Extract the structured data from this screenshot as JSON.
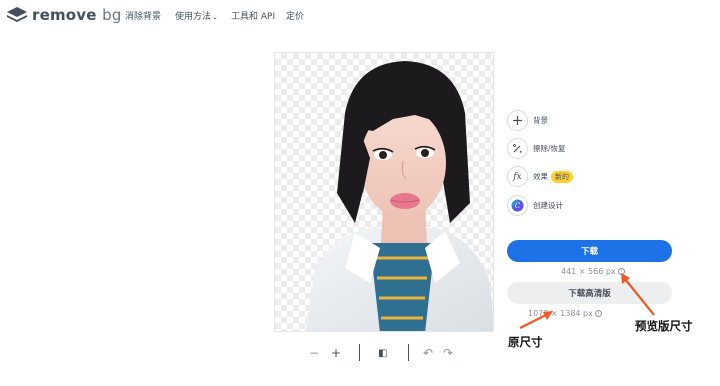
{
  "header": {
    "logo_main": "remove",
    "logo_suffix": "bg",
    "nav": [
      {
        "label": "消除背景"
      },
      {
        "label": "使用方法"
      },
      {
        "label": "工具和 API"
      },
      {
        "label": "定价"
      }
    ],
    "nav_dropdown_icon": "chevron-down-icon"
  },
  "tools": [
    {
      "icon": "plus-icon",
      "glyph": "+",
      "label": "背景"
    },
    {
      "icon": "magic-wand-icon",
      "glyph": "⟋",
      "label": "擦除/恢复"
    },
    {
      "icon": "fx-icon",
      "glyph": "fx",
      "label": "效果",
      "badge": "新的"
    },
    {
      "icon": "canva-icon",
      "glyph": "C",
      "label": "创建设计"
    }
  ],
  "download": {
    "label": "下载",
    "preview_size": "441 × 566 px",
    "hd_label": "下载高清版",
    "original_size": "1079 × 1384 px"
  },
  "annotations": {
    "original": "原尺寸",
    "preview": "预览版尺寸",
    "color": "#ee5a24"
  },
  "toolbar": {
    "zoom_out": "−",
    "zoom_in": "+",
    "compare": "◧",
    "undo": "↶",
    "redo": "↷"
  },
  "colors": {
    "primary": "#1d72e8",
    "text": "#454f5b",
    "badge": "#ffd02f"
  }
}
